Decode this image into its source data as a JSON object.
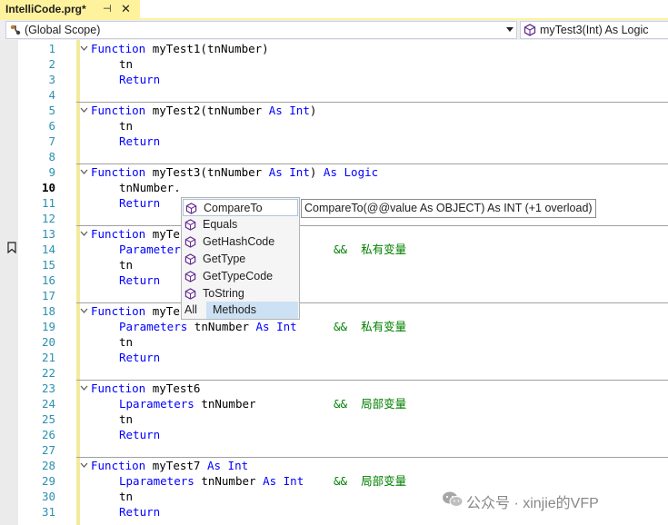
{
  "tab": {
    "title": "IntelliCode.prg*",
    "pin_glyph": "⊣",
    "close_glyph": "✕"
  },
  "navbar": {
    "scope": "(Global Scope)",
    "member": "myTest3(Int) As Logic"
  },
  "line_numbers": [
    "1",
    "2",
    "3",
    "4",
    "5",
    "6",
    "7",
    "8",
    "9",
    "10",
    "11",
    "12",
    "13",
    "14",
    "15",
    "16",
    "17",
    "18",
    "19",
    "20",
    "21",
    "22",
    "23",
    "24",
    "25",
    "26",
    "27",
    "28",
    "29",
    "30",
    "31"
  ],
  "current_line": 10,
  "code": {
    "l1": {
      "kw": "Function",
      "rest": " myTest1(tnNumber)"
    },
    "l2": "tn",
    "l3": "Return",
    "l5": {
      "kw": "Function",
      "a": " myTest2(tnNumber ",
      "kw2": "As",
      "b": " ",
      "kw3": "Int",
      "c": ")"
    },
    "l6": "tn",
    "l7": "Return",
    "l9": {
      "kw": "Function",
      "a": " myTest3(tnNumber ",
      "kw2": "As",
      "b": " ",
      "kw3": "Int",
      "c": ") ",
      "kw4": "As",
      "d": " ",
      "kw5": "Logic"
    },
    "l10": "tnNumber.",
    "l11": "Return",
    "l13": {
      "kw": "Function",
      "a": " myTe"
    },
    "l14": {
      "kw": "Parameter",
      "comment": "&&  私有变量"
    },
    "l15": "tn",
    "l16": "Return",
    "l18": {
      "kw": "Function",
      "a": " myTe"
    },
    "l19": {
      "kw": "Parameters",
      "a": " tnNumber ",
      "kw2": "As",
      "b": " ",
      "kw3": "Int",
      "comment": "&&  私有变量"
    },
    "l20": "tn",
    "l21": "Return",
    "l23": {
      "kw": "Function",
      "a": " myTest6"
    },
    "l24": {
      "kw": "Lparameters",
      "a": " tnNumber",
      "comment": "&&  局部变量"
    },
    "l25": "tn",
    "l26": "Return",
    "l28": {
      "kw": "Function",
      "a": " myTest7 ",
      "kw2": "As",
      "b": " ",
      "kw3": "Int"
    },
    "l29": {
      "kw": "Lparameters",
      "a": " tnNumber ",
      "kw2": "As",
      "b": " ",
      "kw3": "Int",
      "comment": "&&  局部变量"
    },
    "l30": "tn",
    "l31": "Return"
  },
  "completion": {
    "items": [
      "CompareTo",
      "Equals",
      "GetHashCode",
      "GetType",
      "GetTypeCode",
      "ToString"
    ],
    "selected": 0,
    "filters": {
      "all": "All",
      "methods": "Methods"
    },
    "active_filter": "Methods",
    "item_icon": "method-cube-icon"
  },
  "tooltip": "CompareTo(@@value As OBJECT) As INT (+1 overload)",
  "watermark": {
    "text": "公众号 · xinjie的VFP"
  },
  "colors": {
    "keyword": "#0000ff",
    "comment": "#008000",
    "line_number": "#2b91af",
    "tab_active": "#fff29d",
    "change_bar": "#f2ea9d",
    "method_icon": "#652d90"
  }
}
